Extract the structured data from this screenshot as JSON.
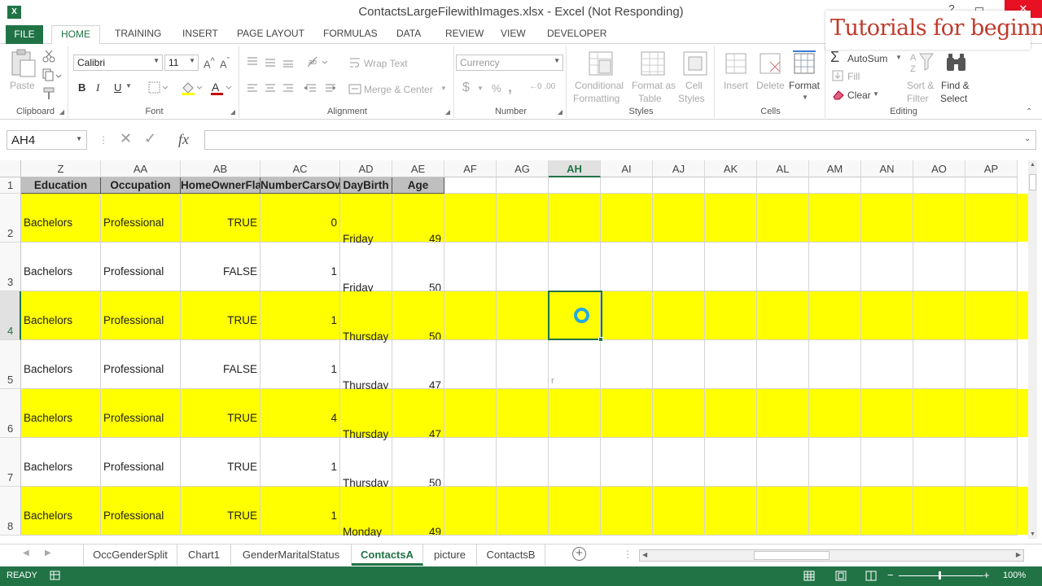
{
  "window": {
    "title": "ContactsLargeFilewithImages.xlsx - Excel (Not Responding)",
    "logo": "X"
  },
  "watermark": "Tutorials for beginners",
  "tabs": [
    "FILE",
    "HOME",
    "TRAINING",
    "INSERT",
    "PAGE LAYOUT",
    "FORMULAS",
    "DATA",
    "REVIEW",
    "VIEW",
    "DEVELOPER"
  ],
  "ribbon": {
    "clipboard": {
      "label": "Clipboard",
      "paste": "Paste"
    },
    "font": {
      "label": "Font",
      "name": "Calibri",
      "size": "11",
      "bold": "B",
      "italic": "I",
      "underline": "U"
    },
    "alignment": {
      "label": "Alignment",
      "wrap": "Wrap Text",
      "merge": "Merge & Center"
    },
    "number": {
      "label": "Number",
      "format": "Currency",
      "dollar": "$",
      "percent": "%",
      "comma": ","
    },
    "styles": {
      "label": "Styles",
      "cond1": "Conditional",
      "cond2": "Formatting",
      "fmt1": "Format as",
      "fmt2": "Table",
      "cell1": "Cell",
      "cell2": "Styles"
    },
    "cells": {
      "label": "Cells",
      "insert": "Insert",
      "delete": "Delete",
      "format": "Format"
    },
    "editing": {
      "label": "Editing",
      "autosum": "AutoSum",
      "fill": "Fill",
      "clear": "Clear",
      "sort1": "Sort &",
      "sort2": "Filter",
      "find1": "Find &",
      "find2": "Select"
    }
  },
  "namebox": "AH4",
  "fx": "fx",
  "columns": [
    "Z",
    "AA",
    "AB",
    "AC",
    "AD",
    "AE",
    "AF",
    "AG",
    "AH",
    "AI",
    "AJ",
    "AK",
    "AL",
    "AM",
    "AN",
    "AO",
    "AP"
  ],
  "selected_column": "AH",
  "header_row": [
    "Education",
    "Occupation",
    "HomeOwnerFlag",
    "NumberCarsOwned",
    "DayBirth",
    "Age"
  ],
  "rows": [
    {
      "num": "2",
      "education": "Bachelors",
      "occupation": "Professional",
      "owner": "TRUE",
      "cars": "0",
      "day": "Friday",
      "age": "49"
    },
    {
      "num": "3",
      "education": "Bachelors",
      "occupation": "Professional",
      "owner": "FALSE",
      "cars": "1",
      "day": "Friday",
      "age": "50"
    },
    {
      "num": "4",
      "education": "Bachelors",
      "occupation": "Professional",
      "owner": "TRUE",
      "cars": "1",
      "day": "Thursday",
      "age": "50"
    },
    {
      "num": "5",
      "education": "Bachelors",
      "occupation": "Professional",
      "owner": "FALSE",
      "cars": "1",
      "day": "Thursday",
      "age": "47"
    },
    {
      "num": "6",
      "education": "Bachelors",
      "occupation": "Professional",
      "owner": "TRUE",
      "cars": "4",
      "day": "Thursday",
      "age": "47"
    },
    {
      "num": "7",
      "education": "Bachelors",
      "occupation": "Professional",
      "owner": "TRUE",
      "cars": "1",
      "day": "Thursday",
      "age": "50"
    },
    {
      "num": "8",
      "education": "Bachelors",
      "occupation": "Professional",
      "owner": "TRUE",
      "cars": "1",
      "day": "Monday",
      "age": "49"
    }
  ],
  "row1_num": "1",
  "stray_char": "r",
  "sheets": [
    "OccGenderSplit",
    "Chart1",
    "GenderMaritalStatus",
    "ContactsA",
    "picture",
    "ContactsB"
  ],
  "active_sheet": "ContactsA",
  "status": {
    "ready": "READY",
    "zoom": "100%"
  },
  "colors": {
    "accent": "#217346",
    "highlight": "#ffff00",
    "header_fill": "#bfbfbf"
  }
}
